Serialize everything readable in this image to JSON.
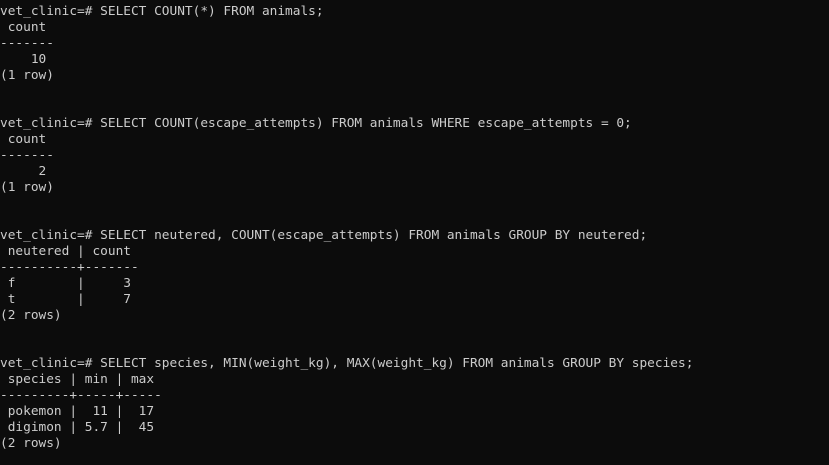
{
  "terminal": {
    "lines": [
      "vet_clinic=# SELECT COUNT(*) FROM animals;",
      " count",
      "-------",
      "    10",
      "(1 row)",
      "",
      "",
      "vet_clinic=# SELECT COUNT(escape_attempts) FROM animals WHERE escape_attempts = 0;",
      " count",
      "-------",
      "     2",
      "(1 row)",
      "",
      "",
      "vet_clinic=# SELECT neutered, COUNT(escape_attempts) FROM animals GROUP BY neutered;",
      " neutered | count",
      "----------+-------",
      " f        |     3",
      " t        |     7",
      "(2 rows)",
      "",
      "",
      "vet_clinic=# SELECT species, MIN(weight_kg), MAX(weight_kg) FROM animals GROUP BY species;",
      " species | min | max",
      "---------+-----+-----",
      " pokemon |  11 |  17",
      " digimon | 5.7 |  45",
      "(2 rows)"
    ]
  }
}
